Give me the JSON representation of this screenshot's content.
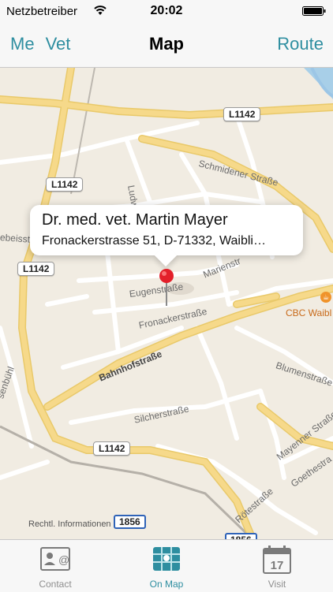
{
  "status_bar": {
    "carrier": "Netzbetreiber",
    "time": "20:02"
  },
  "nav": {
    "left_items": [
      "Me",
      "Vet"
    ],
    "title": "Map",
    "right_item": "Route"
  },
  "map": {
    "road_badges": [
      "L1142",
      "L1142",
      "L1142",
      "L1142"
    ],
    "route_badges": [
      "1856",
      "1856"
    ],
    "street_labels": [
      "Schmidener Straße",
      "Ludw",
      "ebeisstr",
      "Marienstr",
      "Eugenstraße",
      "Fronackerstraße",
      "Bahnhofstraße",
      "Blumenstraße",
      "Silcherstraße",
      "Mayenner Straße",
      "Goethestra",
      "Rötestraße",
      "senbühl"
    ],
    "poi": "CBC Waibl",
    "callout": {
      "title": "Dr. med. vet. Martin Mayer",
      "subtitle": "Fronackerstrasse 51, D-71332, Waibli…"
    },
    "legal": "Rechtl. Informationen"
  },
  "tabs": [
    {
      "label": "Contact",
      "icon": "contact-card-icon",
      "active": false
    },
    {
      "label": "On Map",
      "icon": "map-icon",
      "active": true
    },
    {
      "label": "Visit",
      "icon": "calendar-icon",
      "active": false,
      "calendar_day": "17"
    }
  ],
  "colors": {
    "accent": "#2e8ea0",
    "map_bg": "#f1ece2",
    "major_road": "#f6d98a",
    "pin": "#e3202a"
  }
}
